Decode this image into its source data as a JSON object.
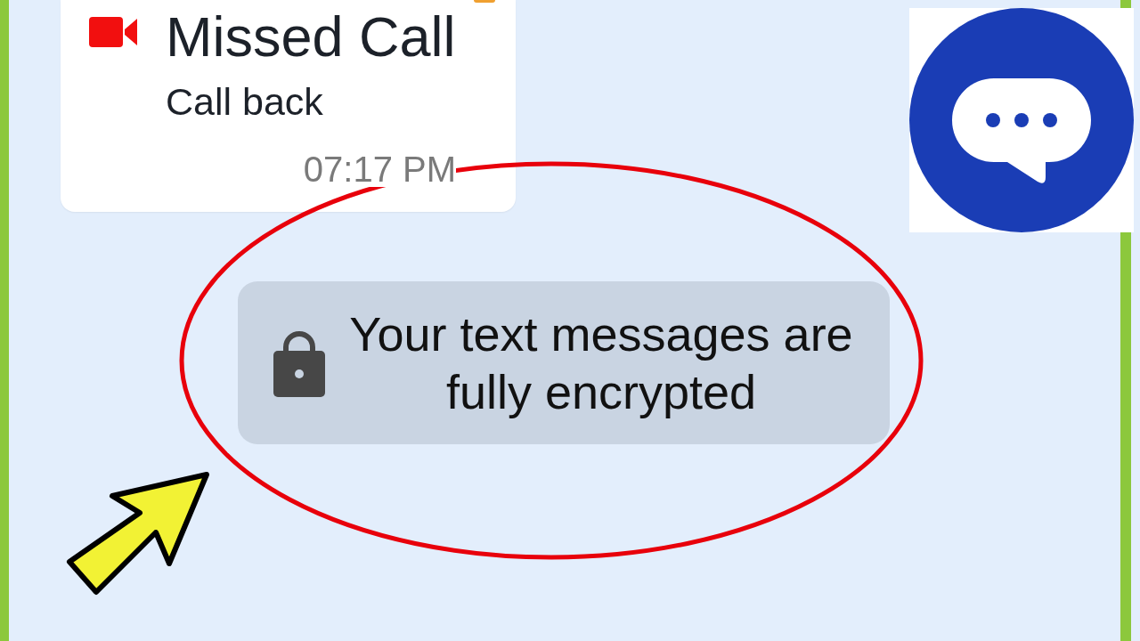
{
  "missed_call_card": {
    "title": "Missed Call",
    "action": "Call back",
    "time": "07:17 PM"
  },
  "encryption_notice": {
    "text": "Your text messages are fully encrypted"
  }
}
